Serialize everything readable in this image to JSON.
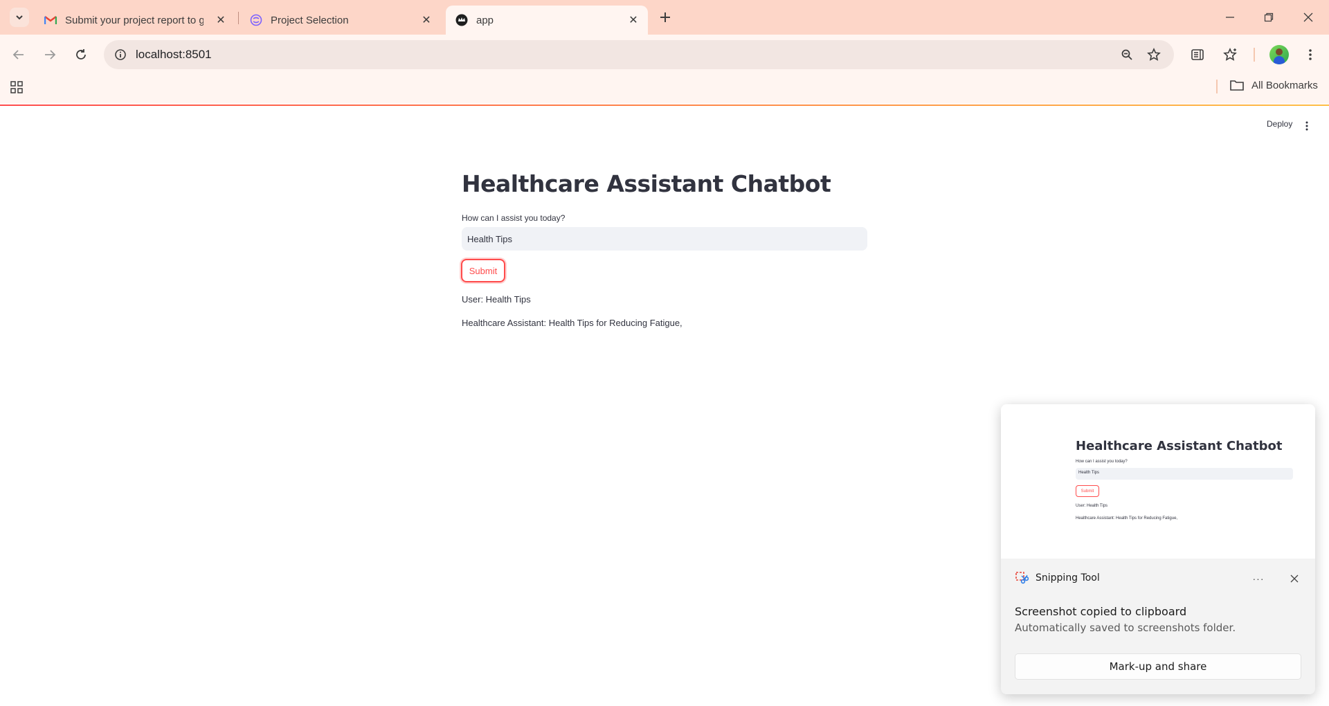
{
  "browser": {
    "tabs": [
      {
        "title": "Submit your project report to g",
        "icon": "gmail-icon"
      },
      {
        "title": "Project Selection",
        "icon": "project-logo-icon"
      },
      {
        "title": "app",
        "icon": "streamlit-crown-icon"
      }
    ],
    "url": "localhost:8501",
    "bookmarks_label": "All Bookmarks"
  },
  "app": {
    "header": {
      "deploy_label": "Deploy"
    },
    "title": "Healthcare Assistant Chatbot",
    "input_label": "How can I assist you today?",
    "input_value": "Health Tips",
    "submit_label": "Submit",
    "messages": [
      "User: Health Tips",
      "Healthcare Assistant: Health Tips for Reducing Fatigue,"
    ],
    "accent_color": "#ff4b4b"
  },
  "toast": {
    "app_name": "Snipping Tool",
    "title": "Screenshot copied to clipboard",
    "body": "Automatically saved to screenshots folder.",
    "action_label": "Mark-up and share",
    "more_label": "···"
  }
}
